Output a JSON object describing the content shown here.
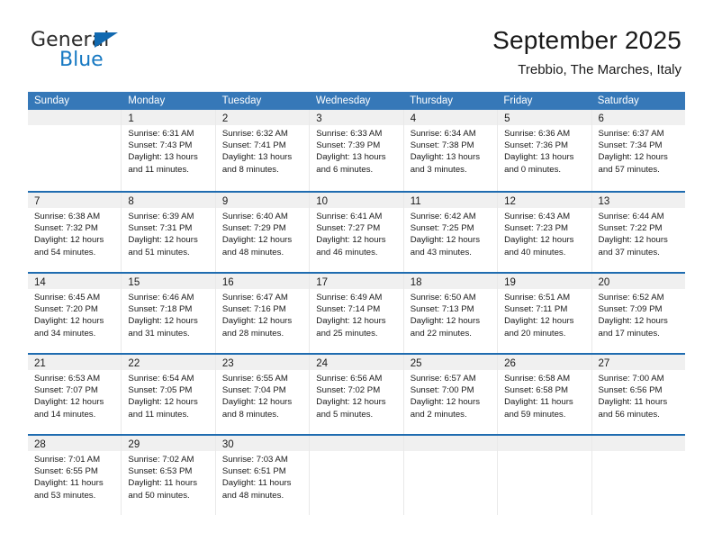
{
  "brand": {
    "name_part1": "General",
    "name_part2": "Blue",
    "logo_icon": "triangle-logo-icon"
  },
  "header": {
    "title": "September 2025",
    "subtitle": "Trebbio, The Marches, Italy"
  },
  "colors": {
    "header_band": "#3678b8",
    "row_divider": "#1f6cb0",
    "day_head_bg": "#f0f0f0",
    "brand_blue": "#1678c2"
  },
  "weekdays": [
    "Sunday",
    "Monday",
    "Tuesday",
    "Wednesday",
    "Thursday",
    "Friday",
    "Saturday"
  ],
  "weeks": [
    [
      {
        "day": "",
        "empty": true
      },
      {
        "day": "1",
        "sunrise": "Sunrise: 6:31 AM",
        "sunset": "Sunset: 7:43 PM",
        "daylight1": "Daylight: 13 hours",
        "daylight2": "and 11 minutes."
      },
      {
        "day": "2",
        "sunrise": "Sunrise: 6:32 AM",
        "sunset": "Sunset: 7:41 PM",
        "daylight1": "Daylight: 13 hours",
        "daylight2": "and 8 minutes."
      },
      {
        "day": "3",
        "sunrise": "Sunrise: 6:33 AM",
        "sunset": "Sunset: 7:39 PM",
        "daylight1": "Daylight: 13 hours",
        "daylight2": "and 6 minutes."
      },
      {
        "day": "4",
        "sunrise": "Sunrise: 6:34 AM",
        "sunset": "Sunset: 7:38 PM",
        "daylight1": "Daylight: 13 hours",
        "daylight2": "and 3 minutes."
      },
      {
        "day": "5",
        "sunrise": "Sunrise: 6:36 AM",
        "sunset": "Sunset: 7:36 PM",
        "daylight1": "Daylight: 13 hours",
        "daylight2": "and 0 minutes."
      },
      {
        "day": "6",
        "sunrise": "Sunrise: 6:37 AM",
        "sunset": "Sunset: 7:34 PM",
        "daylight1": "Daylight: 12 hours",
        "daylight2": "and 57 minutes."
      }
    ],
    [
      {
        "day": "7",
        "sunrise": "Sunrise: 6:38 AM",
        "sunset": "Sunset: 7:32 PM",
        "daylight1": "Daylight: 12 hours",
        "daylight2": "and 54 minutes."
      },
      {
        "day": "8",
        "sunrise": "Sunrise: 6:39 AM",
        "sunset": "Sunset: 7:31 PM",
        "daylight1": "Daylight: 12 hours",
        "daylight2": "and 51 minutes."
      },
      {
        "day": "9",
        "sunrise": "Sunrise: 6:40 AM",
        "sunset": "Sunset: 7:29 PM",
        "daylight1": "Daylight: 12 hours",
        "daylight2": "and 48 minutes."
      },
      {
        "day": "10",
        "sunrise": "Sunrise: 6:41 AM",
        "sunset": "Sunset: 7:27 PM",
        "daylight1": "Daylight: 12 hours",
        "daylight2": "and 46 minutes."
      },
      {
        "day": "11",
        "sunrise": "Sunrise: 6:42 AM",
        "sunset": "Sunset: 7:25 PM",
        "daylight1": "Daylight: 12 hours",
        "daylight2": "and 43 minutes."
      },
      {
        "day": "12",
        "sunrise": "Sunrise: 6:43 AM",
        "sunset": "Sunset: 7:23 PM",
        "daylight1": "Daylight: 12 hours",
        "daylight2": "and 40 minutes."
      },
      {
        "day": "13",
        "sunrise": "Sunrise: 6:44 AM",
        "sunset": "Sunset: 7:22 PM",
        "daylight1": "Daylight: 12 hours",
        "daylight2": "and 37 minutes."
      }
    ],
    [
      {
        "day": "14",
        "sunrise": "Sunrise: 6:45 AM",
        "sunset": "Sunset: 7:20 PM",
        "daylight1": "Daylight: 12 hours",
        "daylight2": "and 34 minutes."
      },
      {
        "day": "15",
        "sunrise": "Sunrise: 6:46 AM",
        "sunset": "Sunset: 7:18 PM",
        "daylight1": "Daylight: 12 hours",
        "daylight2": "and 31 minutes."
      },
      {
        "day": "16",
        "sunrise": "Sunrise: 6:47 AM",
        "sunset": "Sunset: 7:16 PM",
        "daylight1": "Daylight: 12 hours",
        "daylight2": "and 28 minutes."
      },
      {
        "day": "17",
        "sunrise": "Sunrise: 6:49 AM",
        "sunset": "Sunset: 7:14 PM",
        "daylight1": "Daylight: 12 hours",
        "daylight2": "and 25 minutes."
      },
      {
        "day": "18",
        "sunrise": "Sunrise: 6:50 AM",
        "sunset": "Sunset: 7:13 PM",
        "daylight1": "Daylight: 12 hours",
        "daylight2": "and 22 minutes."
      },
      {
        "day": "19",
        "sunrise": "Sunrise: 6:51 AM",
        "sunset": "Sunset: 7:11 PM",
        "daylight1": "Daylight: 12 hours",
        "daylight2": "and 20 minutes."
      },
      {
        "day": "20",
        "sunrise": "Sunrise: 6:52 AM",
        "sunset": "Sunset: 7:09 PM",
        "daylight1": "Daylight: 12 hours",
        "daylight2": "and 17 minutes."
      }
    ],
    [
      {
        "day": "21",
        "sunrise": "Sunrise: 6:53 AM",
        "sunset": "Sunset: 7:07 PM",
        "daylight1": "Daylight: 12 hours",
        "daylight2": "and 14 minutes."
      },
      {
        "day": "22",
        "sunrise": "Sunrise: 6:54 AM",
        "sunset": "Sunset: 7:05 PM",
        "daylight1": "Daylight: 12 hours",
        "daylight2": "and 11 minutes."
      },
      {
        "day": "23",
        "sunrise": "Sunrise: 6:55 AM",
        "sunset": "Sunset: 7:04 PM",
        "daylight1": "Daylight: 12 hours",
        "daylight2": "and 8 minutes."
      },
      {
        "day": "24",
        "sunrise": "Sunrise: 6:56 AM",
        "sunset": "Sunset: 7:02 PM",
        "daylight1": "Daylight: 12 hours",
        "daylight2": "and 5 minutes."
      },
      {
        "day": "25",
        "sunrise": "Sunrise: 6:57 AM",
        "sunset": "Sunset: 7:00 PM",
        "daylight1": "Daylight: 12 hours",
        "daylight2": "and 2 minutes."
      },
      {
        "day": "26",
        "sunrise": "Sunrise: 6:58 AM",
        "sunset": "Sunset: 6:58 PM",
        "daylight1": "Daylight: 11 hours",
        "daylight2": "and 59 minutes."
      },
      {
        "day": "27",
        "sunrise": "Sunrise: 7:00 AM",
        "sunset": "Sunset: 6:56 PM",
        "daylight1": "Daylight: 11 hours",
        "daylight2": "and 56 minutes."
      }
    ],
    [
      {
        "day": "28",
        "sunrise": "Sunrise: 7:01 AM",
        "sunset": "Sunset: 6:55 PM",
        "daylight1": "Daylight: 11 hours",
        "daylight2": "and 53 minutes."
      },
      {
        "day": "29",
        "sunrise": "Sunrise: 7:02 AM",
        "sunset": "Sunset: 6:53 PM",
        "daylight1": "Daylight: 11 hours",
        "daylight2": "and 50 minutes."
      },
      {
        "day": "30",
        "sunrise": "Sunrise: 7:03 AM",
        "sunset": "Sunset: 6:51 PM",
        "daylight1": "Daylight: 11 hours",
        "daylight2": "and 48 minutes."
      },
      {
        "day": "",
        "empty": true
      },
      {
        "day": "",
        "empty": true
      },
      {
        "day": "",
        "empty": true
      },
      {
        "day": "",
        "empty": true
      }
    ]
  ]
}
